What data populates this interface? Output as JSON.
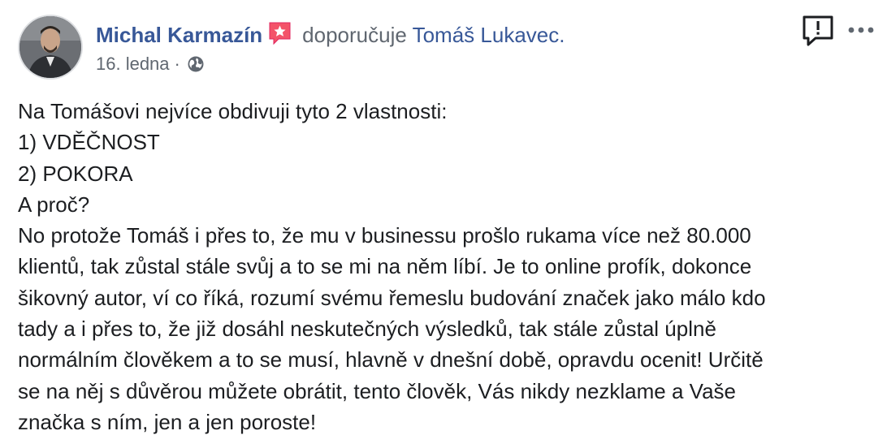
{
  "post": {
    "author_name": "Michal Karmazín",
    "action_text": "doporučuje",
    "target_name": "Tomáš Lukavec.",
    "date": "16. ledna",
    "separator": "·",
    "privacy_icon": "globe-icon",
    "recommend_icon": "recommend-star-icon",
    "lines": [
      "Na Tomášovi nejvíce obdivuji tyto 2 vlastnosti:",
      "1) VDĚČNOST",
      "2) POKORA",
      "A proč?",
      "No protože Tomáš i přes to, že mu v businessu prošlo rukama více než 80.000",
      "klientů, tak zůstal stále svůj a to se mi na něm líbí. Je to online profík, dokonce",
      "šikovný autor, ví co říká, rozumí svému řemeslu budování značek jako málo kdo",
      "tady a i přes to, že již dosáhl neskutečných výsledků, tak stále zůstal úplně",
      "normálním člověkem a to se musí, hlavně v dnešní době, opravdu ocenit! Určitě",
      "se na něj s důvěrou můžete obrátit, tento člověk, Vás nikdy nezklame a Vaše",
      "značka s ním, jen a jen poroste!"
    ]
  },
  "actions": {
    "report_icon": "report-icon",
    "more_icon": "more-options-icon"
  },
  "colors": {
    "link": "#385898",
    "secondary_text": "#606770",
    "body_text": "#1c1e21",
    "recommend_badge": "#f35369"
  }
}
